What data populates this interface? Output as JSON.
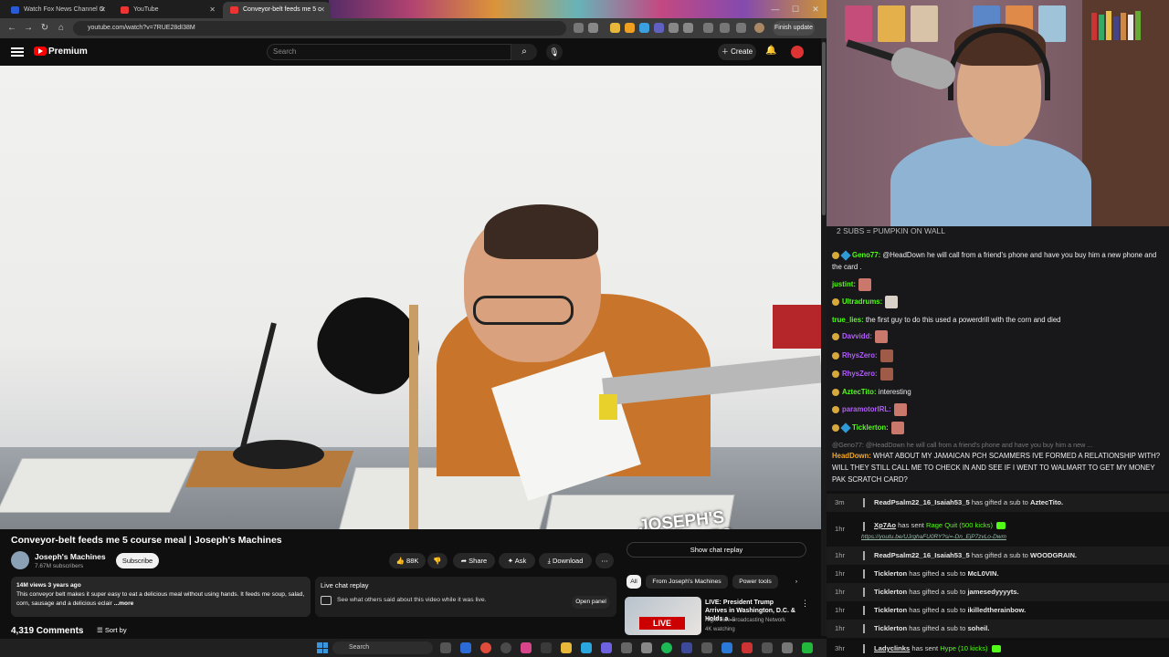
{
  "browser": {
    "tabs": [
      {
        "label": "Watch Fox News Channel O"
      },
      {
        "label": "YouTube"
      },
      {
        "label": "Conveyor-belt feeds me 5 c"
      }
    ],
    "url": "youtube.com/watch?v=7RUE28dI38M",
    "finish_update": "Finish update",
    "window_controls": {
      "min": "—",
      "max": "☐",
      "close": "✕"
    }
  },
  "youtube": {
    "brand": "Premium",
    "search_placeholder": "Search",
    "create_label": "Create",
    "video": {
      "title": "Conveyor-belt feeds me 5 course meal | Joseph's Machines",
      "watermark": "JOSEPH'S MACHINES",
      "channel": "Joseph's Machines",
      "subscribers": "7.67M subscribers",
      "subscribe": "Subscribe",
      "likes": "88K",
      "share": "Share",
      "ask": "Ask",
      "download": "Download",
      "stats": "14M views  3 years ago",
      "description": "This conveyor belt makes it super easy to eat a delicious meal without using hands. It feeds me soup, salad, corn, sausage and a delicious eclair",
      "more": "...more",
      "comments": "4,319 Comments",
      "sort_by": "Sort by"
    },
    "chat_replay": {
      "show_button": "Show chat replay",
      "title": "Live chat replay",
      "subtitle": "See what others said about this video while it was live.",
      "open_panel": "Open panel"
    },
    "chips": [
      "All",
      "From Joseph's Machines",
      "Power tools"
    ],
    "recommended": {
      "badge": "LIVE",
      "title": "LIVE: President Trump Arrives in Washington, D.C. & Holds a ...",
      "channel": "Right Side Broadcasting Network",
      "watching": "4K watching"
    }
  },
  "stream_chat": {
    "pinned": "2 SUBS = PUMPKIN ON WALL",
    "messages": [
      {
        "user": "Geno77:",
        "color": "#53fc18",
        "text": " @HeadDown he will call from a friend's phone and have you buy him a new phone and the card ."
      },
      {
        "user": "justint:",
        "color": "#53fc18",
        "text": ""
      },
      {
        "user": "Ultradrums:",
        "color": "#53fc18",
        "text": ""
      },
      {
        "user": "true_lies:",
        "color": "#53fc18",
        "text": " the first guy to do this used a powerdrill with the corn and died"
      },
      {
        "user": "Davvidd:",
        "color": "#b45cff",
        "text": ""
      },
      {
        "user": "RhysZero:",
        "color": "#b45cff",
        "text": ""
      },
      {
        "user": "RhysZero:",
        "color": "#b45cff",
        "text": ""
      },
      {
        "user": "AztecTito:",
        "color": "#53fc18",
        "text": " interesting"
      },
      {
        "user": "paramotorIRL:",
        "color": "#b45cff",
        "text": ""
      },
      {
        "user": "Ticklerton:",
        "color": "#53fc18",
        "text": ""
      }
    ],
    "reply_context": "@Geno77: @HeadDown he will call from a friend's phone and have you buy him a new ...",
    "reply": {
      "user": "HeadDown:",
      "color": "#f5a623",
      "text": " WHAT ABOUT MY JAMAICAN PCH SCAMMERS IVE FORMED A RELATIONSHIP WITH? WILL THEY STILL CALL ME TO CHECK IN AND SEE IF I WENT TO WALMART TO GET MY MONEY PAK SCRATCH CARD?"
    }
  },
  "events": [
    {
      "time": "3m",
      "user": "ReadPsalm22_16_Isaiah53_5",
      "text": " has gifted a sub to ",
      "target": "AztecTito."
    },
    {
      "time": "1hr",
      "user": "Xp7Ao",
      "text": " has sent ",
      "target": "Rage Quit (500 kicks)",
      "link": "https://youtu.be/UJrghaFU0RY?si=-Dn_EjP7zvLo-Dwm"
    },
    {
      "time": "1hr",
      "user": "ReadPsalm22_16_Isaiah53_5",
      "text": " has gifted a sub to ",
      "target": "WOODGRAIN."
    },
    {
      "time": "1hr",
      "user": "Ticklerton",
      "text": " has gifted a sub to ",
      "target": "McL0VIN."
    },
    {
      "time": "1hr",
      "user": "Ticklerton",
      "text": " has gifted a sub to ",
      "target": "jamesedyyyyts."
    },
    {
      "time": "1hr",
      "user": "Ticklerton",
      "text": " has gifted a sub to ",
      "target": "ikilledtherainbow."
    },
    {
      "time": "1hr",
      "user": "Ticklerton",
      "text": " has gifted a sub to ",
      "target": "soheil."
    },
    {
      "time": "3hr",
      "user": "Ladyclinks",
      "text": " has sent ",
      "target": "Hype (10 kicks)"
    }
  ],
  "taskbar": {
    "search": "Search"
  }
}
